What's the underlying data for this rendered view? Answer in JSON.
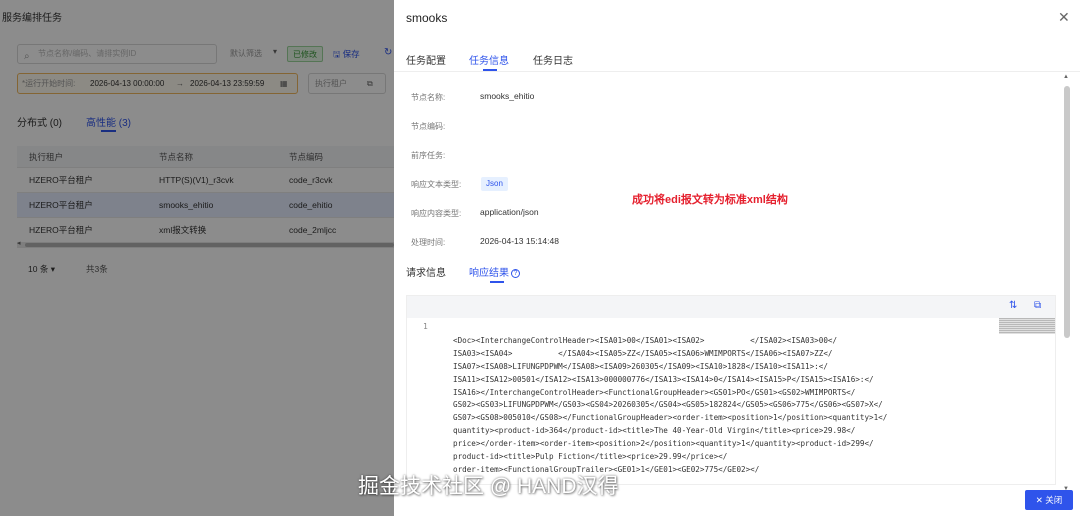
{
  "background": {
    "title": "服务编排任务",
    "search_placeholder": "节点名称/编码、请排实例ID",
    "filter_label": "默认筛选",
    "modified_tag": "已修改",
    "save_label": "保存",
    "range": {
      "label": "*运行开始时间:",
      "from": "2026-04-13 00:00:00",
      "to": "2026-04-13 23:59:59"
    },
    "tenant_placeholder": "执行租户",
    "tabs": [
      {
        "label": "分布式 (0)"
      },
      {
        "label": "高性能 (3)"
      }
    ],
    "table": {
      "headers": [
        "执行租户",
        "节点名称",
        "节点编码"
      ],
      "rows": [
        [
          "HZERO平台租户",
          "HTTP(S)(V1)_r3cvk",
          "code_r3cvk"
        ],
        [
          "HZERO平台租户",
          "smooks_ehitio",
          "code_ehitio"
        ],
        [
          "HZERO平台租户",
          "xml报文转换",
          "code_2mljcc"
        ]
      ]
    },
    "page_size": "10 条",
    "total": "共3条"
  },
  "drawer": {
    "title": "smooks",
    "tabs": [
      "任务配置",
      "任务信息",
      "任务日志"
    ],
    "fields": [
      {
        "label": "节点名称:",
        "value": "smooks_ehitio"
      },
      {
        "label": "节点编码:",
        "value": ""
      },
      {
        "label": "前序任务:",
        "value": ""
      },
      {
        "label": "响应文本类型:",
        "value": "Json"
      },
      {
        "label": "响应内容类型:",
        "value": "application/json"
      },
      {
        "label": "处理时间:",
        "value": "2026-04-13 15:14:48"
      }
    ],
    "annotation": "成功将edi报文转为标准xml结构",
    "sub_tabs": [
      "请求信息",
      "响应结果"
    ],
    "code": {
      "line_number": "1",
      "lines": [
        "<Doc><InterchangeControlHeader><ISA01>00</ISA01><ISA02>          </ISA02><ISA03>00</",
        "ISA03><ISA04>          </ISA04><ISA05>ZZ</ISA05><ISA06>WMIMPORTS</ISA06><ISA07>ZZ</",
        "ISA07><ISA08>LIFUNGPDPWM</ISA08><ISA09>260305</ISA09><ISA10>1828</ISA10><ISA11>:</",
        "ISA11><ISA12>00501</ISA12><ISA13>000000776</ISA13><ISA14>0</ISA14><ISA15>P</ISA15><ISA16>:</",
        "ISA16></InterchangeControlHeader><FunctionalGroupHeader><GS01>PO</GS01><GS02>WMIMPORTS</",
        "GS02><GS03>LIFUNGPDPWM</GS03><GS04>20260305</GS04><GS05>182824</GS05><GS06>775</GS06><GS07>X</",
        "GS07><GS08>005010</GS08></FunctionalGroupHeader><order-item><position>1</position><quantity>1</",
        "quantity><product-id>364</product-id><title>The 40-Year-Old Virgin</title><price>29.98</",
        "price></order-item><order-item><position>2</position><quantity>1</quantity><product-id>299</",
        "product-id><title>Pulp Fiction</title><price>29.99</price></",
        "order-item><FunctionalGroupTrailer><GE01>1</GE01><GE02>775</GE02></"
      ]
    },
    "close_label": "✕ 关闭"
  },
  "watermark": "掘金技术社区 @ HAND汉得"
}
